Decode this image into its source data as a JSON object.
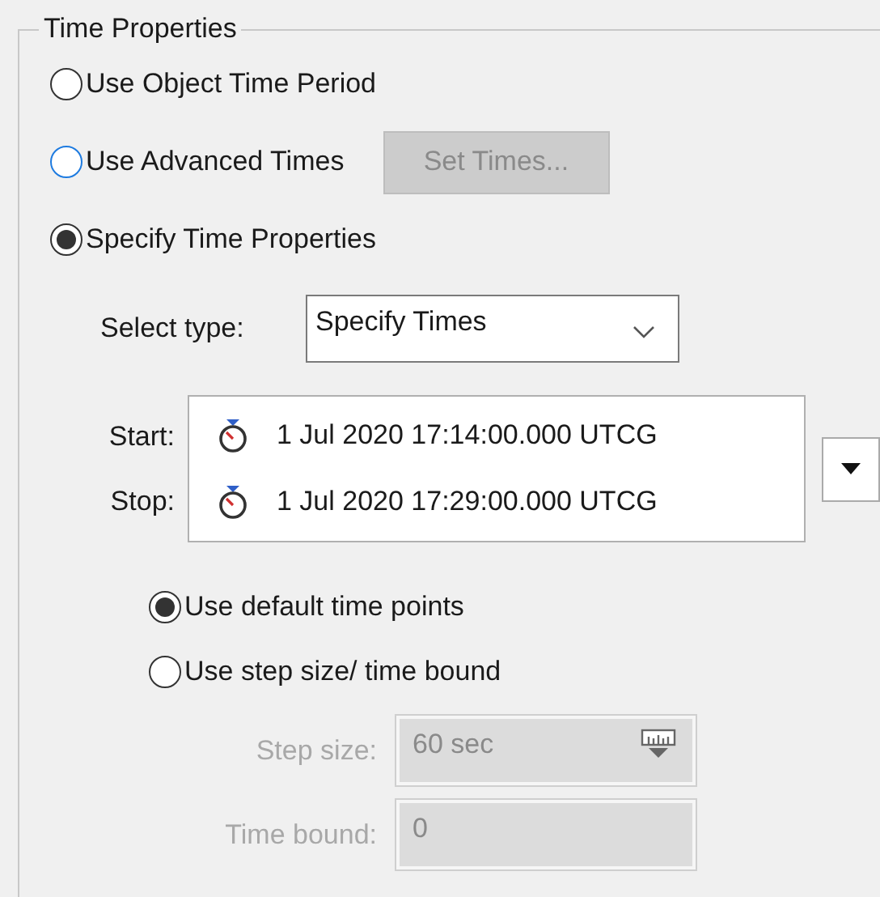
{
  "group": {
    "title": "Time Properties"
  },
  "modes": [
    {
      "label": "Use Object Time Period",
      "selected": false,
      "focused": false
    },
    {
      "label": "Use Advanced Times",
      "selected": false,
      "focused": true,
      "button": {
        "label": "Set Times...",
        "disabled": true
      }
    },
    {
      "label": "Specify Time Properties",
      "selected": true,
      "focused": false
    }
  ],
  "select_type": {
    "label": "Select type:",
    "value": "Specify Times"
  },
  "times": [
    {
      "label": "Start:",
      "value": "1 Jul 2020 17:14:00.000 UTCG"
    },
    {
      "label": "Stop:",
      "value": "1 Jul 2020 17:29:00.000 UTCG"
    }
  ],
  "time_points": [
    {
      "label": "Use default time points",
      "selected": true
    },
    {
      "label": "Use step size/ time bound",
      "selected": false
    }
  ],
  "step_fields": [
    {
      "label": "Step size:",
      "value": "60 sec",
      "disabled": true,
      "kind": "unit"
    },
    {
      "label": "Time bound:",
      "value": "0",
      "disabled": true,
      "kind": "plain"
    }
  ]
}
